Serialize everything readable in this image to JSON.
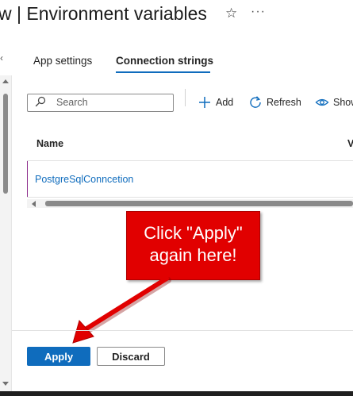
{
  "header": {
    "title": "w | Environment variables",
    "favorite_icon": "star-icon",
    "more_icon": "more-options-icon"
  },
  "tabs": [
    {
      "label": "App settings",
      "selected": false
    },
    {
      "label": "Connection strings",
      "selected": true
    }
  ],
  "toolbar": {
    "search": {
      "placeholder": "Search",
      "value": ""
    },
    "add_label": "Add",
    "refresh_label": "Refresh",
    "show_label": "Show"
  },
  "grid": {
    "columns": [
      "Name",
      "V"
    ],
    "rows": [
      {
        "name": "PostgreSqlConncetion"
      }
    ]
  },
  "callout": {
    "line1": "Click \"Apply\"",
    "line2": "again here!",
    "color": "#e10000"
  },
  "footer": {
    "apply_label": "Apply",
    "discard_label": "Discard"
  },
  "colors": {
    "accent": "#0f6cbd",
    "row_marker": "#8c2a8a"
  }
}
